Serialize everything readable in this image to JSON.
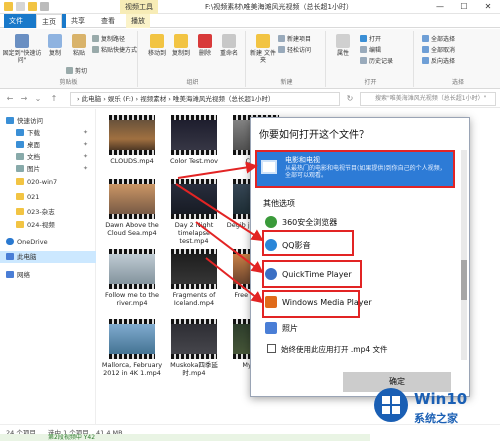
{
  "titlebar": {
    "context_tab_header": "视频工具",
    "path_title": "F:\\视频素材\\唯美海滩风光视频（总长超1小时）",
    "minimize": "—",
    "maximize": "☐",
    "close": "✕"
  },
  "tabs": [
    {
      "label": "文件"
    },
    {
      "label": "主页"
    },
    {
      "label": "共享"
    },
    {
      "label": "查看"
    },
    {
      "label": "播放"
    }
  ],
  "ribbon": {
    "pin_label": "固定到\"快速访问\"",
    "copy_label": "复制",
    "paste_label": "粘贴",
    "copy_path": "复制路径",
    "paste_shortcut": "粘贴快捷方式",
    "cut": "剪切",
    "clipboard_group": "剪贴板",
    "move_to": "移动到",
    "copy_to": "复制到",
    "delete": "删除",
    "rename": "重命名",
    "organize_group": "组织",
    "new_folder": "新建\n文件夹",
    "new_item": "新建项目",
    "easy_access": "轻松访问",
    "new_group": "新建",
    "properties": "属性",
    "open": "打开",
    "edit": "编辑",
    "history": "历史记录",
    "open_group": "打开",
    "select_all": "全部选择",
    "select_none": "全部取消",
    "invert_selection": "反向选择",
    "select_group": "选择"
  },
  "address": {
    "path": "›  此电脑  ›  娱乐 (F:)  ›  视频素材  ›  唯美海滩风光视频（总长超1小时）",
    "search_placeholder": "搜索\"唯美海滩风光视频（总长超1小时）\""
  },
  "nav": {
    "items": [
      {
        "label": "快速访问"
      },
      {
        "label": "下载"
      },
      {
        "label": "桌面"
      },
      {
        "label": "文档"
      },
      {
        "label": "图片"
      },
      {
        "label": "020-win7"
      },
      {
        "label": "021"
      },
      {
        "label": "023-杂志"
      },
      {
        "label": "024-视频"
      },
      {
        "label": "OneDrive"
      },
      {
        "label": "此电脑"
      },
      {
        "label": "网络"
      }
    ]
  },
  "files": [
    {
      "name": "CLOUDS.mp4"
    },
    {
      "name": "Color Test.mov"
    },
    {
      "name": "Coque"
    },
    {
      "name": "Dawn Above the Cloud Sea.mp4"
    },
    {
      "name": "Day 2 Night timelapse test.mp4"
    },
    {
      "name": "Degib jour c autre Vide"
    },
    {
      "name": "Follow me to the river.mp4"
    },
    {
      "name": "Fragments of Iceland.mp4"
    },
    {
      "name": "Free W sunse"
    },
    {
      "name": "Mallorca, February 2012 in 4K 1.mp4"
    },
    {
      "name": "Muskoka四季延时.mp4"
    },
    {
      "name": "My Gard"
    }
  ],
  "status": {
    "count": "24 个项目",
    "selected": "选中 1 个项目",
    "size": "41.4 MB"
  },
  "dialog": {
    "title": "你要如何打开这个文件？",
    "recommended_name": "电影和电视",
    "recommended_desc": "从最热门的电影和电视节目(如果提供)到你自己的个人视频，全部可以观看。",
    "other_options": "其他选项",
    "options": [
      {
        "label": "360安全浏览器",
        "icon_color": "#3a9a3a"
      },
      {
        "label": "QQ影音",
        "icon_color": "#2a86d8"
      },
      {
        "label": "QuickTime Player",
        "icon_color": "#3b6fc4"
      },
      {
        "label": "Windows Media Player",
        "icon_color": "#e06a1a"
      },
      {
        "label": "照片",
        "icon_color": "#4a7ed6"
      }
    ],
    "always_use": "始终使用此应用打开 .mp4 文件",
    "ok": "确定"
  },
  "watermark": {
    "line1": "Win10",
    "line2": "系统之家"
  },
  "bottom_strip": "第2段视频中 Y42",
  "colors": {
    "accent": "#1979ca",
    "dialog_highlight": "#2d7bd6",
    "annotation_red": "#e22424"
  }
}
